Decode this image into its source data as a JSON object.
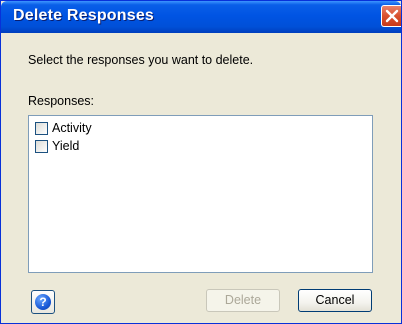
{
  "window": {
    "title": "Delete Responses"
  },
  "dialog": {
    "instruction": "Select the responses you want to delete.",
    "list_label": "Responses:",
    "items": [
      {
        "label": "Activity",
        "checked": false
      },
      {
        "label": "Yield",
        "checked": false
      }
    ]
  },
  "buttons": {
    "help_glyph": "?",
    "delete_label": "Delete",
    "delete_enabled": false,
    "cancel_label": "Cancel"
  },
  "icons": {
    "close": "close-icon",
    "help": "help-icon"
  }
}
